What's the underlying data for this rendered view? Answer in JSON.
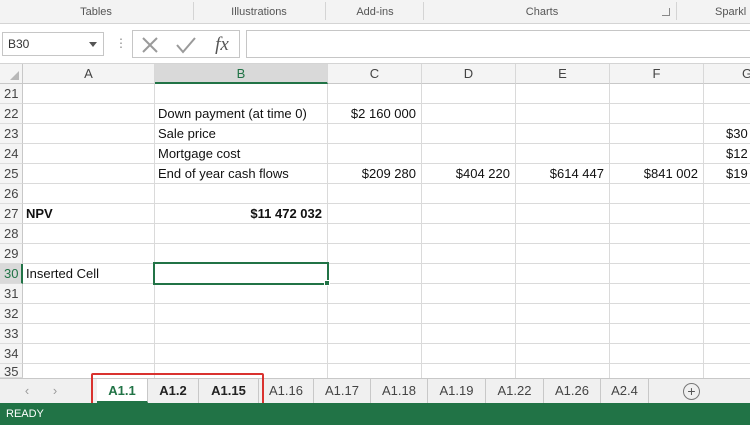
{
  "ribbon": {
    "groups": [
      "Tables",
      "Illustrations",
      "Add-ins",
      "Charts",
      "Sparkl"
    ]
  },
  "formula_bar": {
    "name_box": "B30",
    "cancel_icon": "cancel-x-icon",
    "enter_icon": "checkmark-icon",
    "function_label": "fx",
    "formula_value": ""
  },
  "columns": [
    "A",
    "B",
    "C",
    "D",
    "E",
    "F",
    "G"
  ],
  "rows": [
    "21",
    "22",
    "23",
    "24",
    "25",
    "26",
    "27",
    "28",
    "29",
    "30",
    "31",
    "32",
    "33",
    "34",
    "35"
  ],
  "cells": {
    "r22": {
      "b": "Down payment (at time 0)",
      "c": "$2 160 000"
    },
    "r23": {
      "b": "Sale price",
      "g": "$30"
    },
    "r24": {
      "b": "Mortgage cost",
      "g": "$12"
    },
    "r25": {
      "b": "End of year cash flows",
      "c": "$209 280",
      "d": "$404 220",
      "e": "$614 447",
      "f": "$841 002",
      "g": "$19"
    },
    "r27": {
      "a": "NPV",
      "b": "$11 472 032"
    },
    "r30": {
      "a": "Inserted Cell"
    }
  },
  "sheet_tabs": [
    "A1.1",
    "A1.2",
    "A1.15",
    "A1.16",
    "A1.17",
    "A1.18",
    "A1.19",
    "A1.22",
    "A1.26",
    "A2.4"
  ],
  "active_tab": "A1.1",
  "status": "READY",
  "colors": {
    "accent": "#217346",
    "highlight_box": "#d9322f"
  }
}
